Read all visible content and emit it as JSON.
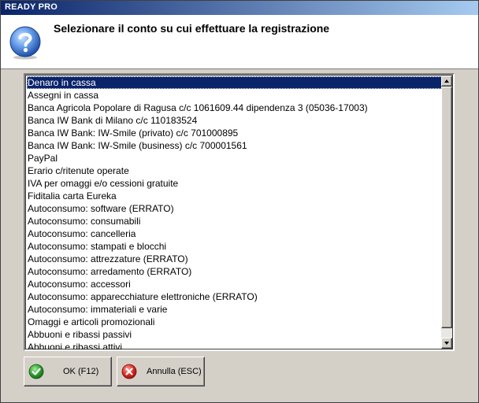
{
  "window": {
    "title": "READY PRO"
  },
  "header": {
    "icon": "question-icon",
    "prompt": "Selezionare il conto su cui effettuare la registrazione"
  },
  "accounts": {
    "selected_index": 0,
    "items": [
      "Denaro in cassa",
      "Assegni in cassa",
      "Banca Agricola Popolare di Ragusa c/c 1061609.44 dipendenza 3 (05036-17003)",
      "Banca IW Bank di Milano c/c 110183524",
      "Banca IW Bank: IW-Smile (privato) c/c 701000895",
      "Banca IW Bank: IW-Smile (business) c/c 700001561",
      "PayPal",
      "Erario c/ritenute operate",
      "IVA per omaggi e/o cessioni gratuite",
      "Fiditalia carta Eureka",
      "Autoconsumo: software (ERRATO)",
      "Autoconsumo: consumabili",
      "Autoconsumo: cancelleria",
      "Autoconsumo: stampati e blocchi",
      "Autoconsumo: attrezzature (ERRATO)",
      "Autoconsumo: arredamento (ERRATO)",
      "Autoconsumo: accessori",
      "Autoconsumo: apparecchiature elettroniche (ERRATO)",
      "Autoconsumo: immateriali e varie",
      "Omaggi e articoli promozionali",
      "Abbuoni e ribassi passivi",
      "Abbuoni e ribassi attivi"
    ]
  },
  "buttons": {
    "ok_label": "OK (F12)",
    "ok_icon": "check-icon",
    "cancel_label": "Annulla (ESC)",
    "cancel_icon": "cancel-icon"
  },
  "colors": {
    "selection": "#0a246a",
    "ok_green": "#2e9a2e",
    "cancel_red": "#d8261e",
    "question_blue": "#2a6fd0"
  }
}
